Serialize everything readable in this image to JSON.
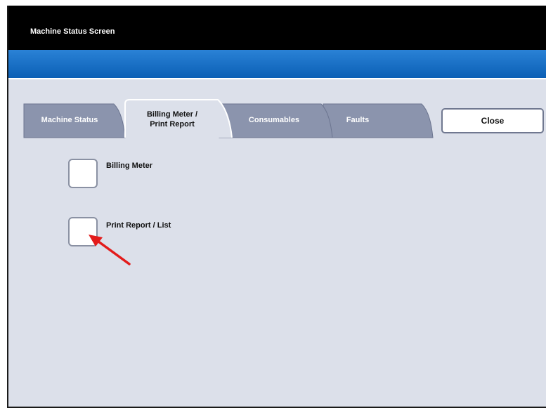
{
  "window": {
    "title": "Machine Status Screen"
  },
  "tabs": [
    {
      "label": "Machine Status",
      "active": false
    },
    {
      "label_line1": "Billing Meter /",
      "label_line2": "Print Report",
      "active": true
    },
    {
      "label": "Consumables",
      "active": false
    },
    {
      "label": "Faults",
      "active": false
    }
  ],
  "close_button": {
    "label": "Close"
  },
  "options": [
    {
      "label": "Billing Meter"
    },
    {
      "label": "Print Report / List"
    }
  ],
  "colors": {
    "title_bar": "#000000",
    "banner": "#1a73c8",
    "panel": "#dce0ea",
    "inactive_tab": "#8b94ad",
    "annotation_arrow": "#e31b1b"
  }
}
